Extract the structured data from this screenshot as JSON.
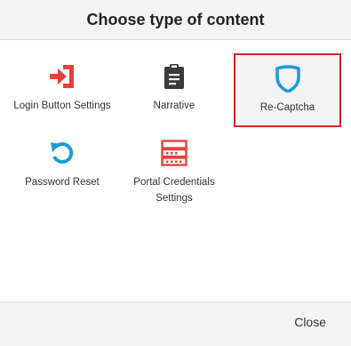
{
  "dialog": {
    "title": "Choose type of content",
    "close_label": "Close"
  },
  "items": [
    {
      "label": "Login Button Settings",
      "icon": "login-icon",
      "color": "#e8403d",
      "selected": false
    },
    {
      "label": "Narrative",
      "icon": "clipboard-icon",
      "color": "#3a3a3a",
      "selected": false
    },
    {
      "label": "Re-Captcha",
      "icon": "shield-icon",
      "color": "#1e9bd7",
      "selected": true
    },
    {
      "label": "Password Reset",
      "icon": "undo-icon",
      "color": "#1e9bd7",
      "selected": false
    },
    {
      "label": "Portal Credentials Settings",
      "icon": "server-icon",
      "color": "#e8403d",
      "selected": false
    }
  ],
  "colors": {
    "selection_border": "#d3232a",
    "header_bg": "#f4f4f4"
  }
}
